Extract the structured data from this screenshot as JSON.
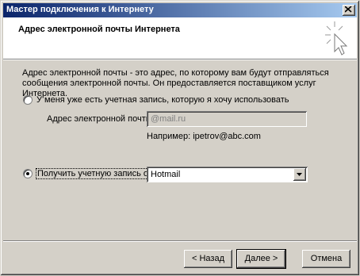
{
  "window": {
    "title": "Мастер подключения к Интернету"
  },
  "header": {
    "title": "Адрес электронной почты Интернета"
  },
  "body": {
    "description": "Адрес электронной почты - это адрес, по которому вам будут отправляться сообщения электронной почты. Он предоставляется поставщиком услуг Интернета.",
    "option_existing": {
      "label": "У меня уже есть учетная запись, которую я хочу использовать",
      "checked": false
    },
    "email_label": "Адрес электронной почты:",
    "email_value": "@mail.ru",
    "example_text": "Например: ipetrov@abc.com",
    "option_new": {
      "label": "Получить учетную запись от:",
      "checked": true
    },
    "provider_select": {
      "selected": "Hotmail"
    }
  },
  "buttons": {
    "back": "< Назад",
    "next": "Далее >",
    "cancel": "Отмена"
  }
}
